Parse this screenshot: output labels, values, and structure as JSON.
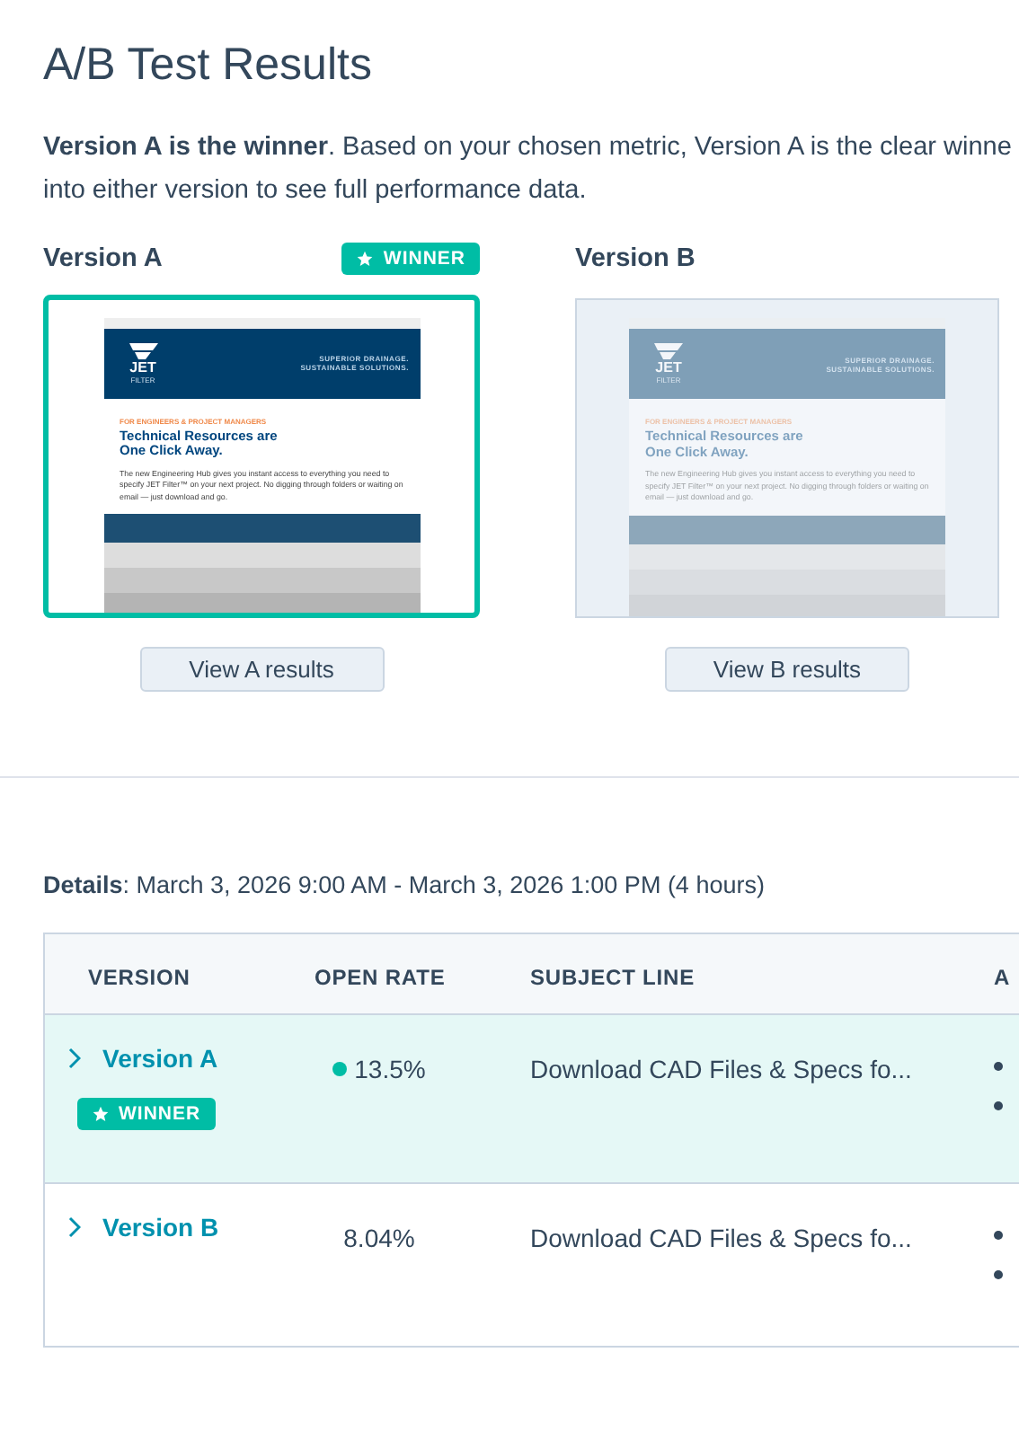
{
  "title": "A/B Test Results",
  "intro": [
    "**Version A is the winner**. Based on your chosen metric, Version A is the clear winne",
    "into either version to see full performance data."
  ],
  "versions": [
    {
      "label": "Version A",
      "winner": true,
      "badge": "WINNER",
      "button": "View A results",
      "preview": {
        "logo": "JET",
        "logo_sub": "FILTER",
        "tagline": [
          "SUPERIOR DRAINAGE.",
          "SUSTAINABLE SOLUTIONS."
        ],
        "eyebrow": "FOR ENGINEERS & PROJECT MANAGERS",
        "headline": [
          "Technical Resources are",
          "One Click Away."
        ],
        "body": "The new Engineering Hub gives you instant access to everything you need to specify JET Filter™ on your next project. No digging through folders or waiting on email — just download and go."
      }
    },
    {
      "label": "Version B",
      "winner": false,
      "button": "View B results",
      "preview": {
        "logo": "JET",
        "logo_sub": "FILTER",
        "tagline": [
          "SUPERIOR DRAINAGE.",
          "SUSTAINABLE SOLUTIONS."
        ],
        "eyebrow": "FOR ENGINEERS & PROJECT MANAGERS",
        "headline": [
          "Technical Resources are",
          "One Click Away."
        ],
        "body": "The new Engineering Hub gives you instant access to everything you need to specify JET Filter™ on your next project. No digging through folders or waiting on email — just download and go."
      }
    }
  ],
  "details": {
    "label": "Details",
    "value": ": March 3, 2026 9:00 AM - March 3, 2026 1:00 PM (4 hours)"
  },
  "table": {
    "columns": [
      "VERSION",
      "OPEN RATE",
      "SUBJECT LINE",
      "A"
    ],
    "rows": [
      {
        "version": "Version A",
        "expanded": false,
        "winner": true,
        "badge": "WINNER",
        "open_rate": "13.5%",
        "subject": "Download CAD Files & Specs fo..."
      },
      {
        "version": "Version B",
        "expanded": false,
        "winner": false,
        "open_rate": "8.04%",
        "subject": "Download CAD Files & Specs fo..."
      }
    ]
  }
}
